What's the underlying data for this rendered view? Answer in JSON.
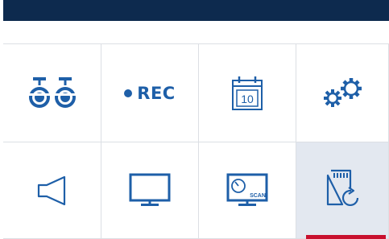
{
  "theme": {
    "topbar_color": "#0d2a4e",
    "icon_color": "#1e5fa8",
    "selected_tile_bg": "#e3e8f0",
    "active_indicator_color": "#c8102e"
  },
  "menu": {
    "tiles": [
      {
        "icon": "cameras-icon",
        "label": ""
      },
      {
        "icon": "record-icon",
        "label": "REC"
      },
      {
        "icon": "calendar-icon",
        "label": "10"
      },
      {
        "icon": "settings-gears-icon",
        "label": ""
      },
      {
        "icon": "speaker-icon",
        "label": ""
      },
      {
        "icon": "monitor-icon",
        "label": ""
      },
      {
        "icon": "monitor-scan-icon",
        "label": "SCAN"
      },
      {
        "icon": "sd-card-restore-icon",
        "label": "",
        "selected": true
      }
    ]
  }
}
